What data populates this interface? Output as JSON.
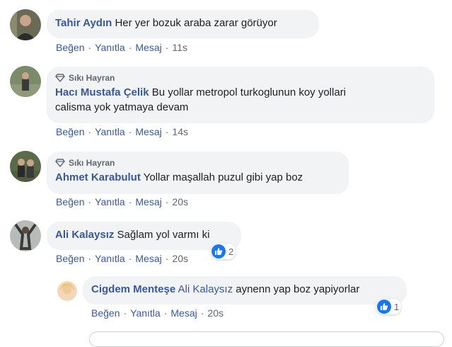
{
  "comments": [
    {
      "author": "Tahir Aydın",
      "text": "Her yer bozuk araba zarar görüyor",
      "time": "11s",
      "badge": ""
    },
    {
      "author": "Hacı Mustafa Çelik",
      "text": "Bu yollar metropol turkoglunun koy yollari",
      "text2": "calisma yok yatmaya devam",
      "time": "14s",
      "badge": "Sıkı Hayran"
    },
    {
      "author": "Ahmet Karabulut",
      "text": "Yollar maşallah puzul gibi yap boz",
      "time": "20s",
      "badge": "Sıkı Hayran"
    },
    {
      "author": "Ali Kalaysız",
      "text": "Sağlam yol varmı ki",
      "time": "20s",
      "badge": "",
      "reactions": "2"
    }
  ],
  "reply": {
    "author": "Cigdem Menteşe",
    "mention": "Ali Kalaysız",
    "text": "aynenn yap boz yapiyorlar",
    "time": "20s",
    "reactions": "1"
  },
  "actions": {
    "like": "Beğen",
    "reply": "Yanıtla",
    "message": "Mesaj",
    "sep": "·"
  },
  "colors": {
    "link": "#385898",
    "bubble": "#f2f3f5",
    "like_blue": "#1877f2"
  }
}
